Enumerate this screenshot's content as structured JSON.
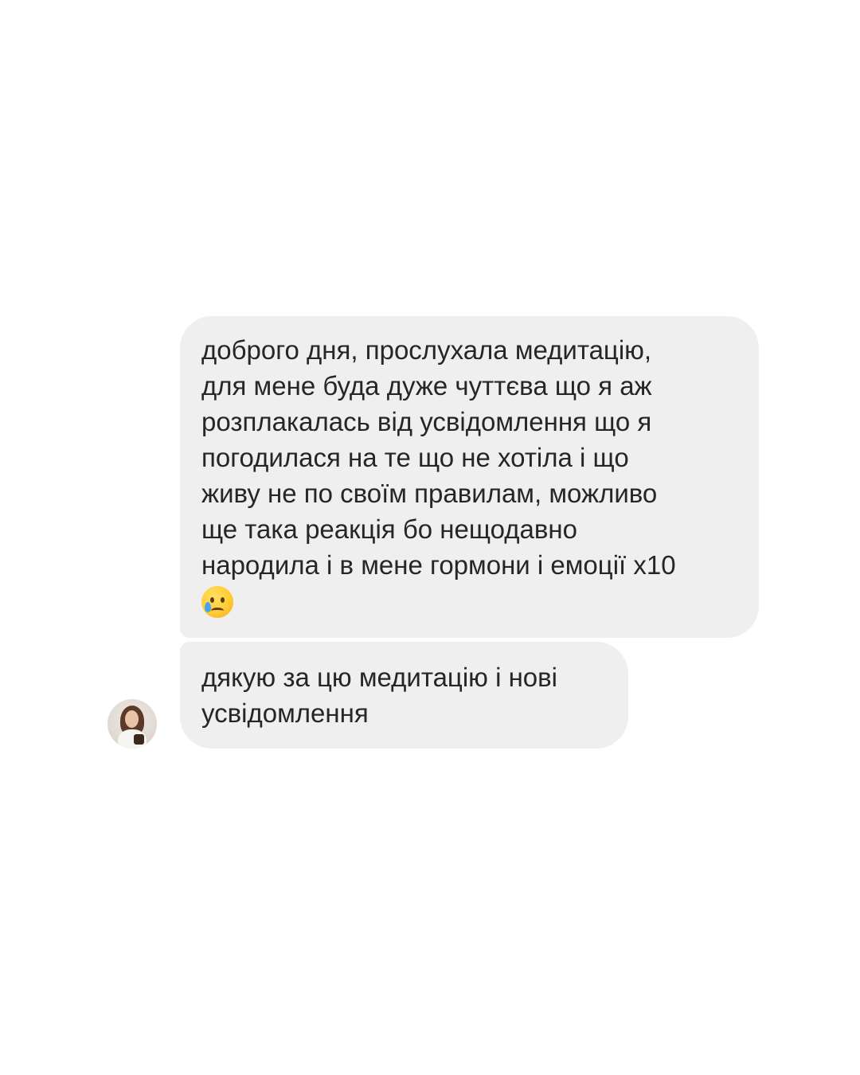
{
  "messages": [
    {
      "lines": [
        "доброго дня, прослухала медитацію,",
        "для мене буда дуже чуттєва що я аж",
        "розплакалась від усвідомлення що я",
        "погодилася на те що не хотіла і що",
        "живу не по своїм правилам, можливо",
        "ще така реакція бо нещодавно",
        "народила і в мене гормони і емоції х10"
      ],
      "emoji": "crying-face"
    },
    {
      "lines": [
        "дякую за цю медитацію і нові",
        "усвідомлення"
      ]
    }
  ],
  "avatar": {
    "description_icon": "user-avatar"
  },
  "colors": {
    "background": "#ffffff",
    "bubble": "#efefef",
    "text": "#262626"
  }
}
